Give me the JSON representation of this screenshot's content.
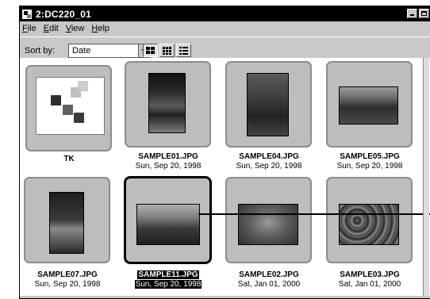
{
  "window": {
    "title": "2:DC220_01"
  },
  "menu": {
    "file": {
      "underline": "F",
      "rest": "ile"
    },
    "edit": {
      "underline": "E",
      "rest": "dit"
    },
    "view": {
      "underline": "V",
      "rest": "iew"
    },
    "help": {
      "underline": "H",
      "rest": "elp"
    }
  },
  "toolbar": {
    "sort_label": "Sort by:",
    "sort_value": "Date",
    "view_modes": [
      "large-icons",
      "small-icons",
      "list"
    ],
    "active_view": "large-icons"
  },
  "items": [
    {
      "name": "TK",
      "date": ""
    },
    {
      "name": "SAMPLE01.JPG",
      "date": "Sun, Sep 20, 1998"
    },
    {
      "name": "SAMPLE04.JPG",
      "date": "Sun, Sep 20, 1998"
    },
    {
      "name": "SAMPLE05.JPG",
      "date": "Sun, Sep 20, 1998"
    },
    {
      "name": "SAMPLE07.JPG",
      "date": "Sun, Sep 20, 1998"
    },
    {
      "name": "SAMPLE11.JPG",
      "date": "Sun, Sep 20, 1998"
    },
    {
      "name": "SAMPLE02.JPG",
      "date": "Sat, Jan 01, 2000"
    },
    {
      "name": "SAMPLE03.JPG",
      "date": "Sat, Jan 01, 2000"
    }
  ],
  "selected_item": "SAMPLE11.JPG",
  "colors": {
    "titlebar": "#000000",
    "window_face": "#c8c8c8",
    "card_face": "#bdbdbd",
    "content_bg": "#ffffff",
    "selection_bg": "#000000"
  }
}
